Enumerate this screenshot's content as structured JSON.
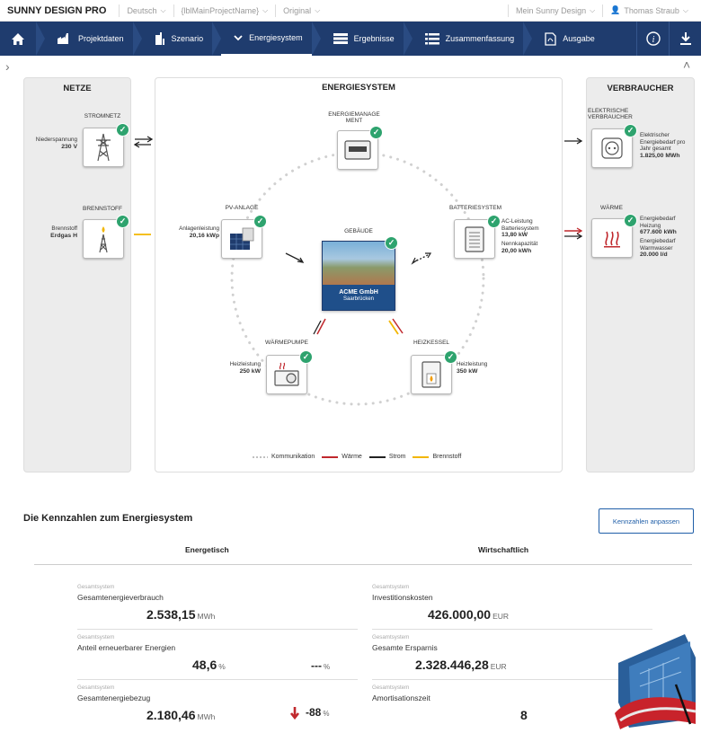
{
  "topbar": {
    "brand": "SUNNY DESIGN PRO",
    "language": "Deutsch",
    "project": "{lblMainProjectName}",
    "variant": "Original",
    "my_design": "Mein Sunny Design",
    "user": "Thomas Straub"
  },
  "nav": {
    "items": [
      {
        "label": "Projektdaten",
        "icon": "factory-icon"
      },
      {
        "label": "Szenario",
        "icon": "building-icon"
      },
      {
        "label": "Energiesystem",
        "icon": "chevron-down-icon"
      },
      {
        "label": "Ergebnisse",
        "icon": "results-icon"
      },
      {
        "label": "Zusammenfassung",
        "icon": "list-icon"
      },
      {
        "label": "Ausgabe",
        "icon": "pdf-icon"
      }
    ],
    "active": "Energiesystem",
    "info": "i",
    "download": "download-icon"
  },
  "netze": {
    "title": "NETZE",
    "stromnetz": {
      "label": "STROMNETZ",
      "side_label": "Niederspannung",
      "side_value": "230 V"
    },
    "brennstoff": {
      "label": "BRENNSTOFF",
      "side_label": "Brennstoff",
      "side_value": "Erdgas H"
    }
  },
  "energiesystem": {
    "title": "ENERGIESYSTEM",
    "management": {
      "label": "ENERGIEMANAGE MENT"
    },
    "pv": {
      "label": "PV-ANLAGE",
      "side_label": "Anlagenleistung",
      "side_value": "20,16 kWp"
    },
    "gebaeude": {
      "label": "GEBÄUDE",
      "name": "ACME GmbH",
      "city": "Saarbrücken"
    },
    "batterie": {
      "label": "BATTERIESYSTEM",
      "l1": "AC-Leistung Batteriesystem",
      "v1": "13,80 kW",
      "l2": "Nennkapazität",
      "v2": "20,00 kWh"
    },
    "waermepumpe": {
      "label": "WÄRMEPUMPE",
      "side_label": "Heizleistung",
      "side_value": "250 kW"
    },
    "heizkessel": {
      "label": "HEIZKESSEL",
      "side_label": "Heizleistung",
      "side_value": "350 kW"
    },
    "legend": [
      "Kommunikation",
      "Wärme",
      "Strom",
      "Brennstoff"
    ]
  },
  "verbraucher": {
    "title": "VERBRAUCHER",
    "elektrisch": {
      "label": "ELEKTRISCHE VERBRAUCHER",
      "l1": "Elektrischer Energiebedarf pro Jahr gesamt",
      "v1": "1.825,00 MWh"
    },
    "waerme": {
      "label": "WÄRME",
      "l1": "Energiebedarf Heizung",
      "v1": "677.600 kWh",
      "l2": "Energiebedarf Warmwasser",
      "v2": "20.000 l/d"
    }
  },
  "colors": {
    "navy": "#1f3c6e",
    "check": "#2ea36e",
    "heat": "#c0282d",
    "fuel": "#f2b600",
    "power": "#222222",
    "comm": "#bbbbbb"
  },
  "kpi": {
    "title": "Die Kennzahlen zum Energiesystem",
    "adjust_button": "Kennzahlen anpassen",
    "col_energy": "Energetisch",
    "col_econ": "Wirtschaftlich",
    "energy": [
      {
        "cat": "Gesamtsystem",
        "name": "Gesamtenergieverbrauch",
        "value": "2.538,15",
        "unit": "MWh"
      },
      {
        "cat": "Gesamtsystem",
        "name": "Anteil erneuerbarer Energien",
        "value": "48,6",
        "unit": "%",
        "cmp": "---",
        "cmp_unit": "%"
      },
      {
        "cat": "Gesamtsystem",
        "name": "Gesamtenergiebezug",
        "value": "2.180,46",
        "unit": "MWh",
        "cmp": "-88",
        "cmp_unit": "%"
      }
    ],
    "econ": [
      {
        "cat": "Gesamtsystem",
        "name": "Investitionskosten",
        "value": "426.000,00",
        "unit": "EUR"
      },
      {
        "cat": "Gesamtsystem",
        "name": "Gesamte Ersparnis",
        "value": "2.328.446,28",
        "unit": "EUR"
      },
      {
        "cat": "Gesamtsystem",
        "name": "Amortisationszeit",
        "value": "8",
        "unit": ""
      }
    ]
  }
}
